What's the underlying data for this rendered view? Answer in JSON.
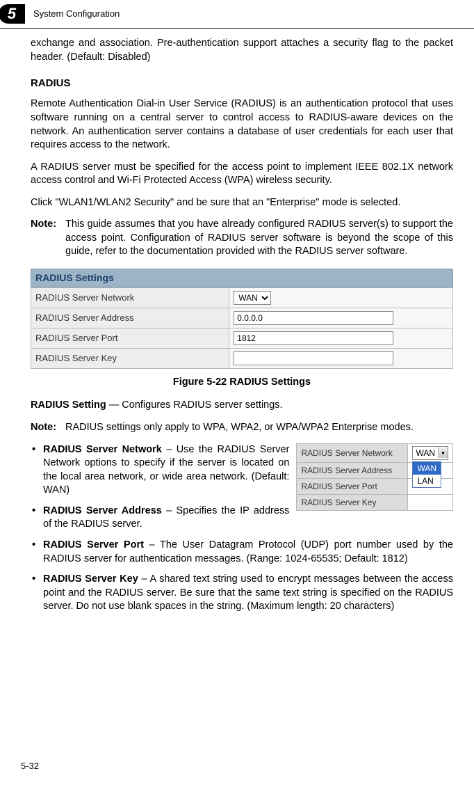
{
  "header": {
    "chapter_number": "5",
    "chapter_title": "System Configuration"
  },
  "intro_para": "exchange and association. Pre-authentication support attaches a security flag to the packet header. (Default: Disabled)",
  "radius": {
    "heading": "RADIUS",
    "para1": "Remote Authentication Dial-in User Service (RADIUS) is an authentication protocol that uses software running on a central server to control access to RADIUS-aware devices on the network. An authentication server contains a database of user credentials for each user that requires access to the network.",
    "para2": "A RADIUS server must be specified for the access point to implement IEEE 802.1X network access control and Wi-Fi Protected Access (WPA) wireless security.",
    "para3": "Click \"WLAN1/WLAN2 Security\" and be sure that an \"Enterprise\" mode is selected.",
    "note1_label": "Note:",
    "note1_text": "This guide assumes that you have already configured RADIUS server(s) to support the access point. Configuration of RADIUS server software is beyond the scope of this guide, refer to the documentation provided with the RADIUS server software."
  },
  "figure_panel": {
    "title": "RADIUS Settings",
    "rows": [
      {
        "label": "RADIUS Server Network",
        "type": "select",
        "value": "WAN"
      },
      {
        "label": "RADIUS Server Address",
        "type": "text",
        "value": "0.0.0.0"
      },
      {
        "label": "RADIUS Server Port",
        "type": "text",
        "value": "1812"
      },
      {
        "label": "RADIUS Server Key",
        "type": "text",
        "value": ""
      }
    ]
  },
  "caption": "Figure 5-22  RADIUS Settings",
  "setting_line": {
    "title": "RADIUS Setting",
    "rest": " — Configures RADIUS server settings."
  },
  "note2": {
    "label": "Note:",
    "text": "RADIUS settings only apply to WPA, WPA2, or WPA/WPA2 Enterprise modes."
  },
  "mini_panel": {
    "rows": [
      "RADIUS Server Network",
      "RADIUS Server Address",
      "RADIUS Server Port",
      "RADIUS Server Key"
    ],
    "dropdown": {
      "selected": "WAN",
      "options": [
        "WAN",
        "LAN"
      ]
    }
  },
  "bullets": [
    {
      "title": "RADIUS Server Network",
      "rest": " – Use the RADIUS Server Network options to specify if the server is located on the local area network, or wide area network. (Default: WAN)"
    },
    {
      "title": "RADIUS Server Address",
      "rest": " – Specifies the IP address of the RADIUS server."
    },
    {
      "title": "RADIUS Server Port",
      "rest": " – The User Datagram Protocol (UDP) port number used by the RADIUS server for authentication messages. (Range: 1024-65535; Default: 1812)"
    },
    {
      "title": "RADIUS Server Key",
      "rest": " – A shared text string used to encrypt messages between the access point and the RADIUS server. Be sure that the same text string is specified on the RADIUS server. Do not use blank spaces in the string. (Maximum length: 20 characters)"
    }
  ],
  "page_number": "5-32"
}
